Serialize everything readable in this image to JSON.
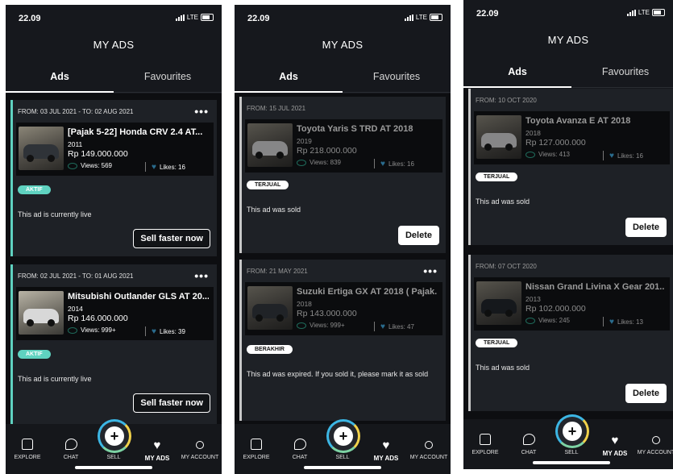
{
  "status_time": "22.09",
  "network": "LTE",
  "title": "MY ADS",
  "tabs": {
    "ads": "Ads",
    "favourites": "Favourites"
  },
  "nav": {
    "explore": "EXPLORE",
    "chat": "CHAT",
    "sell": "SELL",
    "my_ads": "MY ADS",
    "my_account": "MY ACCOUNT"
  },
  "screens": [
    {
      "cards": [
        {
          "period": "FROM: 03 JUL 2021 - TO: 02 AUG 2021",
          "title": "[Pajak 5-22] Honda CRV 2.4 AT...",
          "year": "2011",
          "price": "Rp 149.000.000",
          "views": "Views: 569",
          "likes": "Likes: 16",
          "badge": "AKTIF",
          "status": "This ad is currently live",
          "action": "Sell faster now"
        },
        {
          "period": "FROM: 02 JUL 2021 - TO: 01 AUG 2021",
          "title": "Mitsubishi Outlander GLS AT 20...",
          "year": "2014",
          "price": "Rp 146.000.000",
          "views": "Views: 999+",
          "likes": "Likes: 39",
          "badge": "AKTIF",
          "status": "This ad is currently live",
          "action": "Sell faster now"
        }
      ]
    },
    {
      "cards": [
        {
          "period": "FROM: 15 JUL 2021",
          "title": "Toyota Yaris S TRD AT 2018",
          "year": "2019",
          "price": "Rp 218.000.000",
          "views": "Views: 839",
          "likes": "Likes: 16",
          "badge": "TERJUAL",
          "status": "This ad was sold",
          "action": "Delete"
        },
        {
          "period": "FROM: 21 MAY 2021",
          "title": "Suzuki Ertiga GX AT 2018 ( Pajak...",
          "year": "2018",
          "price": "Rp 143.000.000",
          "views": "Views: 999+",
          "likes": "Likes: 47",
          "badge": "BERAKHIR",
          "status": "This ad was expired. If you sold it, please mark it as sold",
          "action": ""
        }
      ]
    },
    {
      "cards": [
        {
          "period": "FROM: 10 OCT 2020",
          "title": "Toyota Avanza E AT 2018",
          "year": "2018",
          "price": "Rp 127.000.000",
          "views": "Views: 413",
          "likes": "Likes: 16",
          "badge": "TERJUAL",
          "status": "This ad was sold",
          "action": "Delete"
        },
        {
          "period": "FROM: 07 OCT 2020",
          "title": "Nissan Grand Livina X Gear 201...",
          "year": "2013",
          "price": "Rp 102.000.000",
          "views": "Views: 245",
          "likes": "Likes: 13",
          "badge": "TERJUAL",
          "status": "This ad was sold",
          "action": "Delete"
        }
      ]
    }
  ]
}
